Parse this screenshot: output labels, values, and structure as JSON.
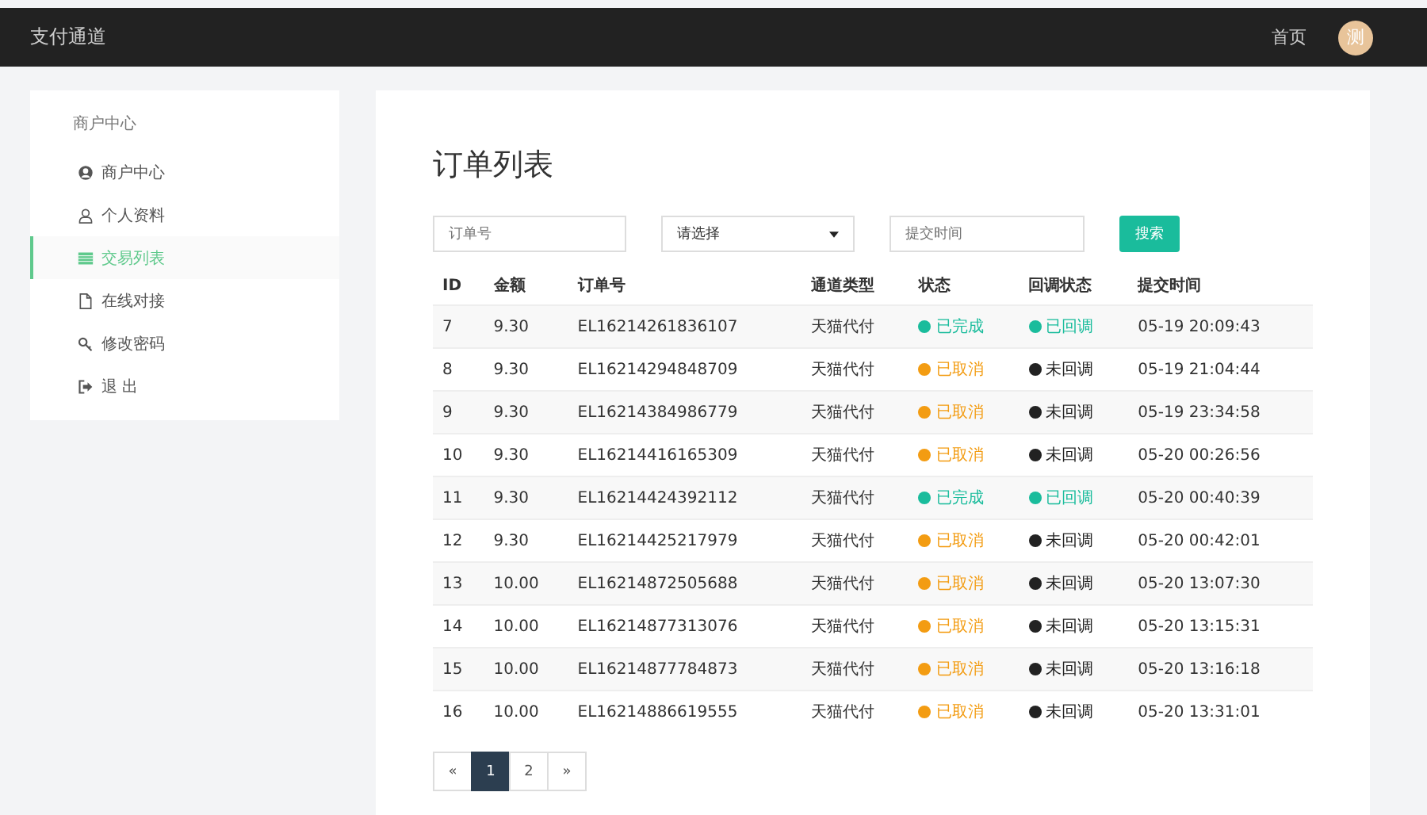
{
  "topbar": {
    "title": "支付通道",
    "home_link": "首页",
    "avatar_text": "测"
  },
  "sidebar": {
    "heading": "商户中心",
    "items": [
      {
        "label": "商户中心",
        "selected": false
      },
      {
        "label": "个人资料",
        "selected": false
      },
      {
        "label": "交易列表",
        "selected": true
      },
      {
        "label": "在线对接",
        "selected": false
      },
      {
        "label": "修改密码",
        "selected": false
      },
      {
        "label": "退 出",
        "selected": false
      }
    ]
  },
  "page_title": "订单列表",
  "filters": {
    "order_placeholder": "订单号",
    "select_value": "请选择",
    "time_placeholder": "提交时间",
    "search_button": "搜索"
  },
  "table": {
    "columns": [
      "ID",
      "金额",
      "订单号",
      "通道类型",
      "状态",
      "回调状态",
      "提交时间"
    ],
    "rows": [
      {
        "id": "7",
        "amount": "9.30",
        "order_no": "EL16214261836107",
        "channel": "天猫代付",
        "status": {
          "text": "已完成",
          "color": "#1abc9c"
        },
        "callback": {
          "text": "已回调",
          "color": "#1abc9c"
        },
        "time": "05-19 20:09:43"
      },
      {
        "id": "8",
        "amount": "9.30",
        "order_no": "EL16214294848709",
        "channel": "天猫代付",
        "status": {
          "text": "已取消",
          "color": "#f39c12"
        },
        "callback": {
          "text": "未回调",
          "color": "#222222"
        },
        "time": "05-19 21:04:44"
      },
      {
        "id": "9",
        "amount": "9.30",
        "order_no": "EL16214384986779",
        "channel": "天猫代付",
        "status": {
          "text": "已取消",
          "color": "#f39c12"
        },
        "callback": {
          "text": "未回调",
          "color": "#222222"
        },
        "time": "05-19 23:34:58"
      },
      {
        "id": "10",
        "amount": "9.30",
        "order_no": "EL16214416165309",
        "channel": "天猫代付",
        "status": {
          "text": "已取消",
          "color": "#f39c12"
        },
        "callback": {
          "text": "未回调",
          "color": "#222222"
        },
        "time": "05-20 00:26:56"
      },
      {
        "id": "11",
        "amount": "9.30",
        "order_no": "EL16214424392112",
        "channel": "天猫代付",
        "status": {
          "text": "已完成",
          "color": "#1abc9c"
        },
        "callback": {
          "text": "已回调",
          "color": "#1abc9c"
        },
        "time": "05-20 00:40:39"
      },
      {
        "id": "12",
        "amount": "9.30",
        "order_no": "EL16214425217979",
        "channel": "天猫代付",
        "status": {
          "text": "已取消",
          "color": "#f39c12"
        },
        "callback": {
          "text": "未回调",
          "color": "#222222"
        },
        "time": "05-20 00:42:01"
      },
      {
        "id": "13",
        "amount": "10.00",
        "order_no": "EL16214872505688",
        "channel": "天猫代付",
        "status": {
          "text": "已取消",
          "color": "#f39c12"
        },
        "callback": {
          "text": "未回调",
          "color": "#222222"
        },
        "time": "05-20 13:07:30"
      },
      {
        "id": "14",
        "amount": "10.00",
        "order_no": "EL16214877313076",
        "channel": "天猫代付",
        "status": {
          "text": "已取消",
          "color": "#f39c12"
        },
        "callback": {
          "text": "未回调",
          "color": "#222222"
        },
        "time": "05-20 13:15:31"
      },
      {
        "id": "15",
        "amount": "10.00",
        "order_no": "EL16214877784873",
        "channel": "天猫代付",
        "status": {
          "text": "已取消",
          "color": "#f39c12"
        },
        "callback": {
          "text": "未回调",
          "color": "#222222"
        },
        "time": "05-20 13:16:18"
      },
      {
        "id": "16",
        "amount": "10.00",
        "order_no": "EL16214886619555",
        "channel": "天猫代付",
        "status": {
          "text": "已取消",
          "color": "#f39c12"
        },
        "callback": {
          "text": "未回调",
          "color": "#222222"
        },
        "time": "05-20 13:31:01"
      }
    ]
  },
  "pagination": [
    {
      "label": "«",
      "selected": false
    },
    {
      "label": "1",
      "selected": true
    },
    {
      "label": "2",
      "selected": false
    },
    {
      "label": "»",
      "selected": false
    }
  ]
}
